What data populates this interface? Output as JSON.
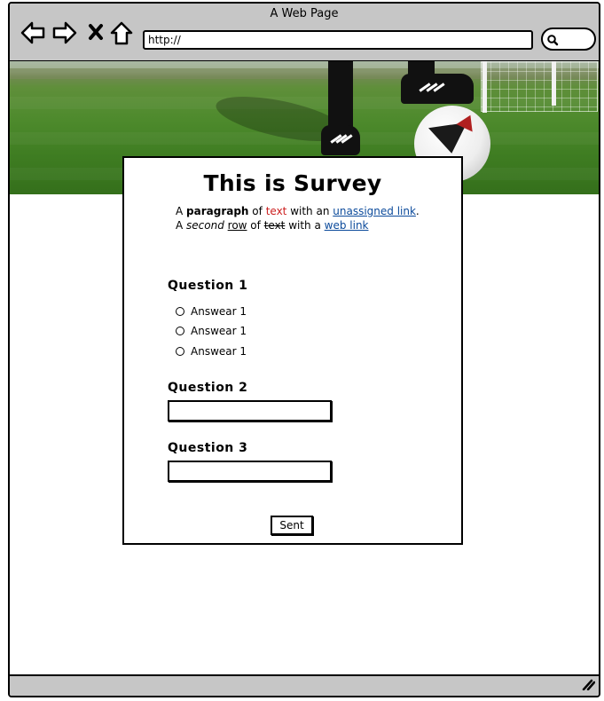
{
  "window": {
    "title": "A Web Page",
    "url": "http://"
  },
  "icons": {
    "back": "back-arrow-icon",
    "forward": "forward-arrow-icon",
    "stop": "close-icon",
    "home": "home-icon",
    "search": "search-icon",
    "resize": "resize-grip-icon"
  },
  "survey": {
    "title": "This is Survey",
    "paragraph": {
      "line1": {
        "a": "A ",
        "bold": "paragraph",
        "of": " of ",
        "red": "text",
        "with": " with an ",
        "link": "unassigned link",
        "end": "."
      },
      "line2": {
        "a": "A ",
        "italic": "second",
        "sp": " ",
        "underline": "row",
        "of": " of ",
        "strike": "text",
        "with": " with a ",
        "link": "web link"
      }
    },
    "question1": {
      "label": "Question 1",
      "options": [
        "Answear 1",
        "Answear 1",
        "Answear 1"
      ]
    },
    "question2": {
      "label": "Question 2",
      "value": ""
    },
    "question3": {
      "label": "Question 3",
      "value": ""
    },
    "submit_label": "Sent"
  },
  "colors": {
    "chrome": "#c6c6c6",
    "red_text": "#cc1f1f",
    "link": "#0b4a9b"
  }
}
